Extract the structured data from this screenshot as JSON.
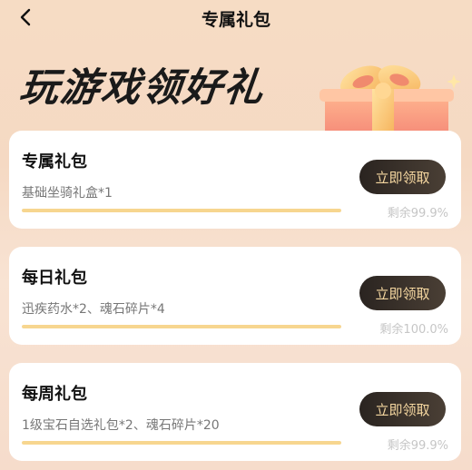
{
  "header": {
    "title": "专属礼包"
  },
  "hero": {
    "title": "玩游戏领好礼"
  },
  "packages": [
    {
      "name": "专属礼包",
      "contents": "基础坐骑礼盒*1",
      "button_label": "立即领取",
      "remaining_text": "剩余99.9%",
      "remaining_fraction": 0.999
    },
    {
      "name": "每日礼包",
      "contents": "迅疾药水*2、魂石碎片*4",
      "button_label": "立即领取",
      "remaining_text": "剩余100.0%",
      "remaining_fraction": 1.0
    },
    {
      "name": "每周礼包",
      "contents": "1级宝石自选礼包*2、魂石碎片*20",
      "button_label": "立即领取",
      "remaining_text": "剩余99.9%",
      "remaining_fraction": 0.999
    }
  ],
  "colors": {
    "accent_gold": "#f5d7a0",
    "progress": "#f7d68f",
    "button_dark": "#2a2420",
    "background": "#f6dcc4"
  },
  "icons": {
    "back": "chevron-left-icon",
    "gift": "gift-box-icon"
  }
}
